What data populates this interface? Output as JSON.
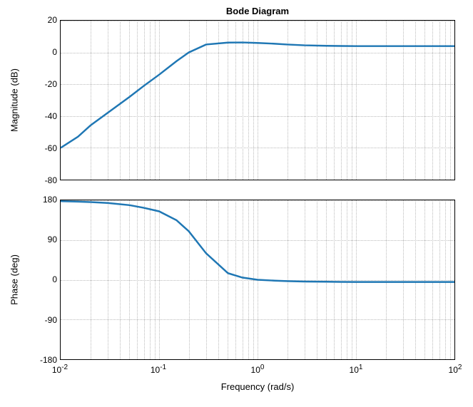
{
  "chart_data": [
    {
      "type": "line",
      "title": "Bode Diagram",
      "xlabel": "",
      "ylabel": "Magnitude (dB)",
      "x_scale": "log",
      "xlim": [
        0.01,
        100
      ],
      "ylim": [
        -80,
        20
      ],
      "yticks": [
        -80,
        -60,
        -40,
        -20,
        0,
        20
      ],
      "x_decade_ticks": [
        0.01,
        0.1,
        1,
        10,
        100
      ],
      "x": [
        0.01,
        0.015,
        0.02,
        0.03,
        0.05,
        0.07,
        0.1,
        0.15,
        0.2,
        0.3,
        0.5,
        0.7,
        1.0,
        1.5,
        2.0,
        3.0,
        5.0,
        7.0,
        10.0,
        15.0,
        20.0,
        30.0,
        50.0,
        70.0,
        100.0
      ],
      "values": [
        -60,
        -53,
        -46,
        -38,
        -28,
        -21,
        -14,
        -5.5,
        0.0,
        5.0,
        6.2,
        6.3,
        6.0,
        5.5,
        5.0,
        4.5,
        4.2,
        4.1,
        4.0,
        4.0,
        4.0,
        4.0,
        4.0,
        4.0,
        4.0
      ]
    },
    {
      "type": "line",
      "title": "",
      "xlabel": "Frequency  (rad/s)",
      "ylabel": "Phase (deg)",
      "x_scale": "log",
      "xlim": [
        0.01,
        100
      ],
      "ylim": [
        -180,
        180
      ],
      "yticks": [
        -180,
        -90,
        0,
        90,
        180
      ],
      "x_decade_ticks": [
        0.01,
        0.1,
        1,
        10,
        100
      ],
      "xtick_labels": [
        "10^{-2}",
        "10^{-1}",
        "10^{0}",
        "10^{1}",
        "10^{2}"
      ],
      "x": [
        0.01,
        0.015,
        0.02,
        0.03,
        0.05,
        0.07,
        0.1,
        0.15,
        0.2,
        0.3,
        0.5,
        0.7,
        1.0,
        1.5,
        2.0,
        3.0,
        5.0,
        7.0,
        10.0,
        15.0,
        20.0,
        30.0,
        50.0,
        70.0,
        100.0
      ],
      "values": [
        178,
        177,
        176,
        174,
        169,
        163,
        155,
        135,
        110,
        60,
        15,
        5,
        0,
        -2,
        -3,
        -4,
        -4.5,
        -4.8,
        -5,
        -5,
        -5,
        -5,
        -5,
        -5,
        -5
      ]
    }
  ],
  "labels": {
    "title": "Bode Diagram",
    "mag_ylabel": "Magnitude (dB)",
    "phase_ylabel": "Phase (deg)",
    "xlabel": "Frequency  (rad/s)",
    "mag_ticks": {
      "m80": "-80",
      "m60": "-60",
      "m40": "-40",
      "m20": "-20",
      "z0": "0",
      "p20": "20"
    },
    "phase_ticks": {
      "m180": "-180",
      "m90": "-90",
      "z0": "0",
      "p90": "90",
      "p180": "180"
    },
    "x_exp": {
      "em2": "-2",
      "em1": "-1",
      "e0": "0",
      "e1": "1",
      "e2": "2"
    },
    "x_base": "10"
  }
}
